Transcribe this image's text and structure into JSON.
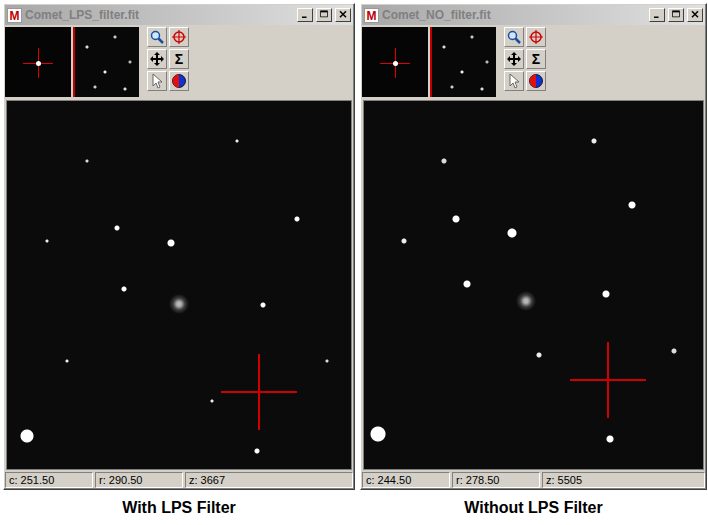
{
  "app_icon": "M",
  "sum_tool_label": "Σ",
  "windows": [
    {
      "title": "Comet_LPS_filter.fit",
      "active": false,
      "status": {
        "c": "c: 251.50",
        "r": "r: 290.50",
        "z": "z: 3667"
      },
      "caption": "With LPS Filter"
    },
    {
      "title": "Comet_NO_filter.fit",
      "active": false,
      "status": {
        "c": "c: 244.50",
        "r": "r: 278.50",
        "z": "z: 5505"
      },
      "caption": "Without LPS Filter"
    }
  ]
}
